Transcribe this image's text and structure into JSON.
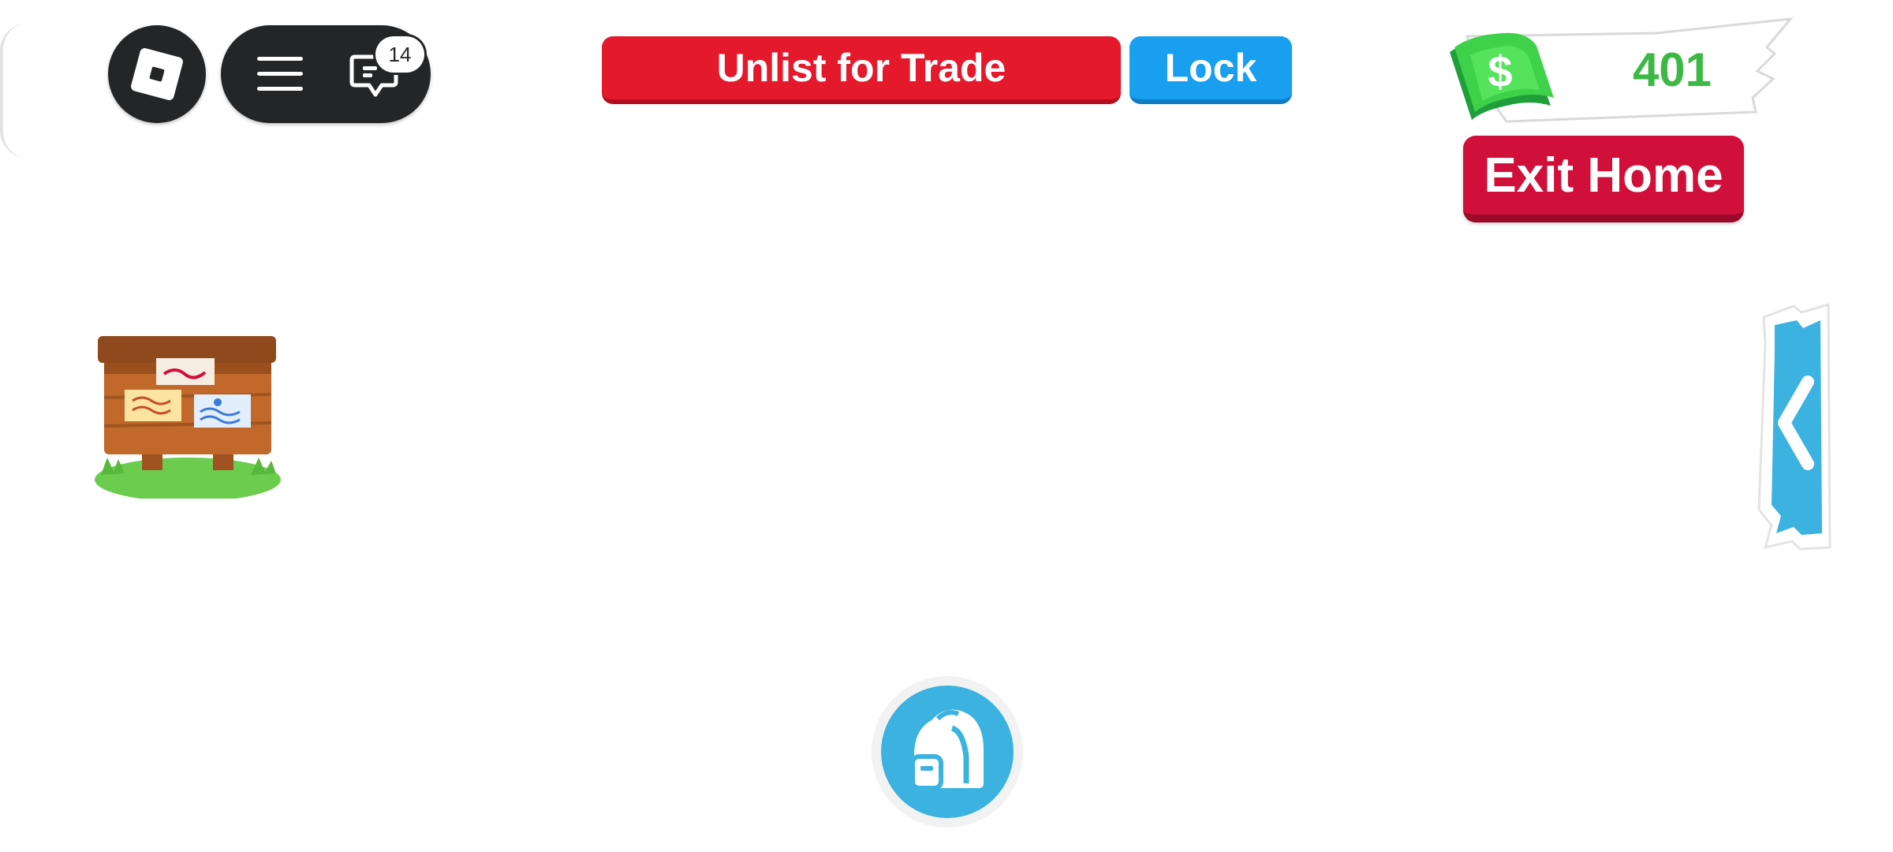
{
  "top_left": {
    "roblox_icon": "roblox-logo-icon",
    "menu_icon": "hamburger-menu-icon",
    "chat_icon": "chat-icon",
    "chat_badge_count": "14"
  },
  "trade": {
    "unlist_label": "Unlist for Trade",
    "lock_label": "Lock"
  },
  "currency": {
    "icon": "dollar-bill-icon",
    "amount": "401"
  },
  "home": {
    "exit_label": "Exit Home"
  },
  "side_tab": {
    "icon": "chevron-left-icon"
  },
  "noticeboard": {
    "icon": "noticeboard-icon"
  },
  "backpack": {
    "icon": "backpack-icon"
  },
  "colors": {
    "unlist_red": "#e4192c",
    "lock_blue": "#189ff0",
    "exit_red": "#d0103b",
    "money_green": "#3db844",
    "side_tab_blue": "#3bb2e0",
    "backpack_blue": "#3bb2e0",
    "roblox_dark": "#232527"
  }
}
